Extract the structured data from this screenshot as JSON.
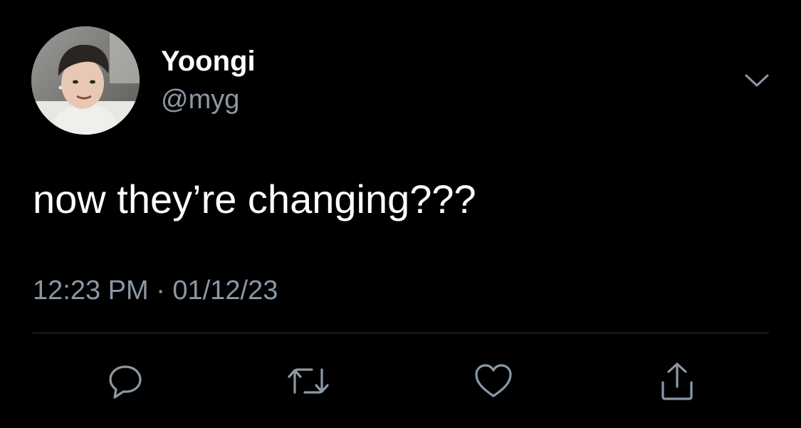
{
  "tweet": {
    "author": {
      "display_name": "Yoongi",
      "handle": "@myg"
    },
    "text": "now they’re changing???",
    "timestamp": "12:23 PM · 01/12/23"
  },
  "icons": {
    "more": "chevron-down-icon",
    "reply": "reply-icon",
    "retweet": "retweet-icon",
    "like": "heart-icon",
    "share": "share-icon"
  },
  "colors": {
    "background": "#000000",
    "primary_text": "#ffffff",
    "secondary_text": "#8b98a5",
    "divider": "#2f3336",
    "icon": "#8b98a5"
  }
}
